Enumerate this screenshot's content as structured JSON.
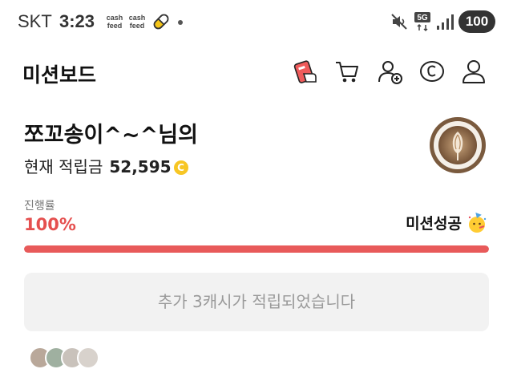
{
  "status_bar": {
    "carrier": "SKT",
    "time": "3:23",
    "cashfeed_label_1": "cash",
    "cashfeed_label_2": "feed",
    "network": "5G",
    "battery": "100"
  },
  "header": {
    "title": "미션보드",
    "icons": [
      "mission-card-icon",
      "cart-icon",
      "add-friend-icon",
      "copyright-coin-icon",
      "profile-icon"
    ]
  },
  "profile": {
    "greeting": "쪼꼬송이^~^님의",
    "balance_label": "현재 적립금",
    "balance_amount": "52,595",
    "coin_symbol": "C"
  },
  "progress": {
    "label": "진행률",
    "value_text": "100%",
    "percent": 100,
    "status": "미션성공",
    "colors": {
      "accent": "#e85a5a",
      "track": "#eeeeee"
    }
  },
  "notice": {
    "text": "추가 3캐시가 적립되었습니다"
  }
}
